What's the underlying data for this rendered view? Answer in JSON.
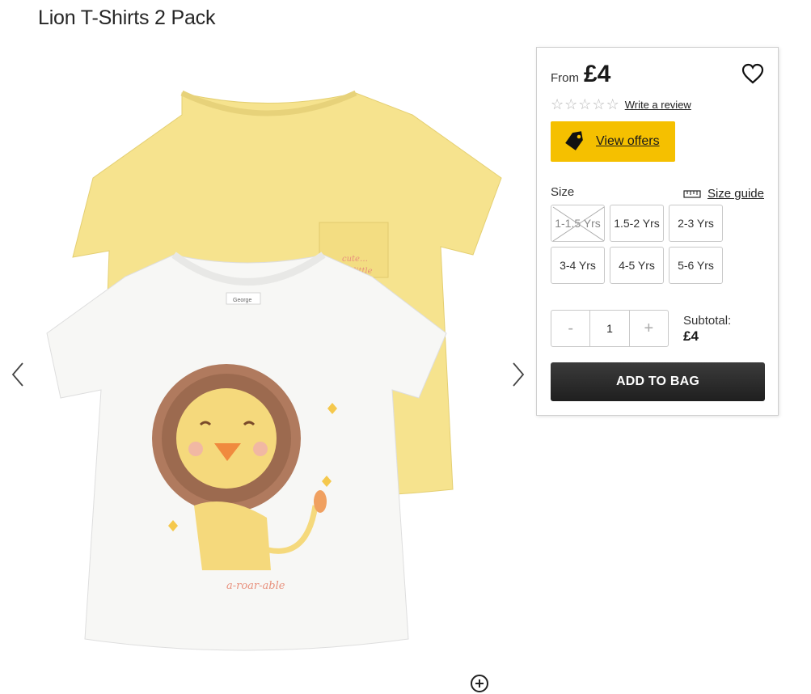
{
  "product": {
    "title": "Lion T-Shirts 2 Pack",
    "image_texts": {
      "pocket_text_1": "cute…",
      "pocket_text_2": "little",
      "neck_label": "George",
      "lion_caption": "a-roar-able"
    }
  },
  "gallery": {
    "prev_icon": "chevron-left-icon",
    "next_icon": "chevron-right-icon",
    "zoom_icon": "zoom-plus-icon"
  },
  "buy_panel": {
    "from_label": "From",
    "price": "£4",
    "rating": {
      "stars_filled": 0,
      "stars_total": 5,
      "review_link": "Write a review"
    },
    "offers_label": "View offers",
    "size_label": "Size",
    "size_guide_label": "Size guide",
    "sizes": [
      {
        "label": "1-1.5 Yrs",
        "available": false
      },
      {
        "label": "1.5-2 Yrs",
        "available": true
      },
      {
        "label": "2-3 Yrs",
        "available": true
      },
      {
        "label": "3-4 Yrs",
        "available": true
      },
      {
        "label": "4-5 Yrs",
        "available": true
      },
      {
        "label": "5-6 Yrs",
        "available": true
      }
    ],
    "quantity": {
      "minus": "-",
      "value": "1",
      "plus": "+"
    },
    "subtotal_label": "Subtotal:",
    "subtotal_value": "£4",
    "add_to_bag": "ADD TO BAG"
  },
  "colors": {
    "offer_yellow": "#f5c000",
    "button_dark": "#2a2a2a",
    "shirt_yellow": "#f6e38e",
    "shirt_white": "#f7f7f5"
  }
}
